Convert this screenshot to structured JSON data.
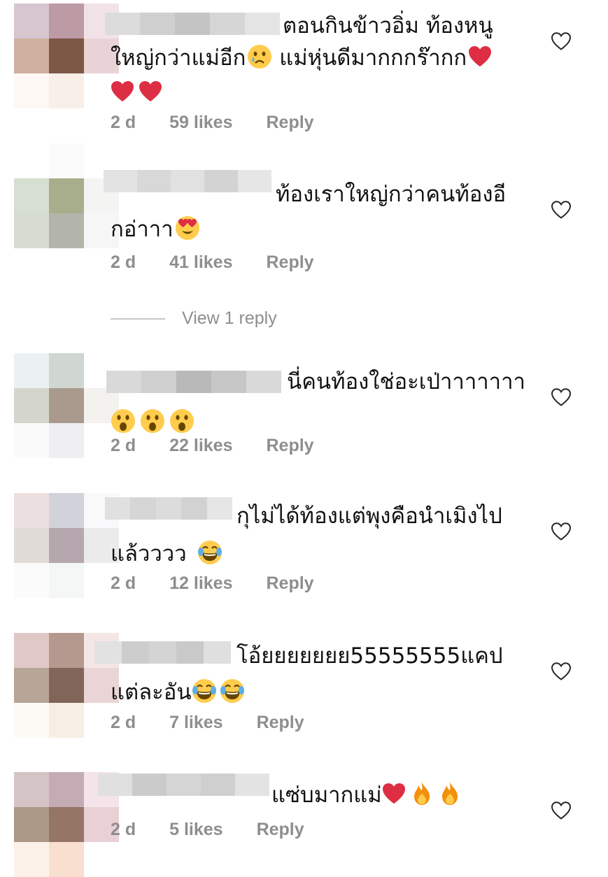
{
  "comments": [
    {
      "avatar_colors": [
        "#d7c5d0",
        "#bc9ba4",
        "#f1e2e8",
        "#cfb09f",
        "#7d5846",
        "#ead3d6",
        "#fdf8f4",
        "#f7efe8",
        "#ffffff"
      ],
      "username_blocks": [
        "#dcdcdc",
        "#cfcfcf",
        "#c4c4c4",
        "#d6d6d6",
        "#e4e4e4"
      ],
      "text_line1": "ตอนกินข้าวอิ่ม ท้องหนู",
      "text_line2": "ใหญ่กว่าแม่อีก",
      "text_line2b": " แม่หุ่นดีมากกกร๊ากก",
      "time": "2 d",
      "likes": "59 likes",
      "reply": "Reply"
    },
    {
      "avatar_colors": [
        "#ffffff",
        "#fbfbfb",
        "#ffffff",
        "#d6dfd1",
        "#a8ae8c",
        "#f4f5f3",
        "#d6dcd0",
        "#b3b5ab",
        "#f6f6f6"
      ],
      "username_blocks": [
        "#e3e3e3",
        "#d8d8d8",
        "#e1e1e1",
        "#d3d3d3",
        "#e6e6e6"
      ],
      "text_line1": "ท้องเราใหญ่กว่าคนท้องอี",
      "text_line2": "กอ่าาา",
      "time": "2 d",
      "likes": "41 likes",
      "reply": "Reply"
    },
    {
      "avatar_colors": [
        "#ebf1f3",
        "#d0d6d0",
        "#ffffff",
        "#d4d6cc",
        "#aa9a8e",
        "#f4f2ef",
        "#fbfafb",
        "#efeff2",
        "#ffffff"
      ],
      "username_blocks": [
        "#d9d9d9",
        "#cfcfcf",
        "#b9b9b9",
        "#c7c7c7",
        "#d9d9d9"
      ],
      "text_line1": "นี่คนท้องใช่อะเป่าาาาาาา",
      "time": "2 d",
      "likes": "22 likes",
      "reply": "Reply"
    },
    {
      "avatar_colors": [
        "#ecdfe0",
        "#d1d2da",
        "#f9f9fb",
        "#e1dbd8",
        "#b5a7ad",
        "#ecebeb",
        "#fbfbfb",
        "#f5f6f6",
        "#ffffff"
      ],
      "username_blocks": [
        "#e0e0e0",
        "#d6d6d6",
        "#dcdcdc",
        "#d2d2d2",
        "#e6e6e6"
      ],
      "text_line1": "กุไม่ได้ท้องแต่พุงคือนำเมิงไป",
      "text_line2": "แล้วววว",
      "time": "2 d",
      "likes": "12 likes",
      "reply": "Reply"
    },
    {
      "avatar_colors": [
        "#dfc8c5",
        "#b5998f",
        "#f5e6e6",
        "#b7a596",
        "#806558",
        "#ead5d6",
        "#fdfaf6",
        "#f5efe6",
        "#ffffff"
      ],
      "username_blocks": [
        "#e2e2e2",
        "#cdcdcd",
        "#d4d4d4",
        "#c9c9c9",
        "#dfdfdf"
      ],
      "text_line1": "โอ้ยยยยยยย55555555แคป",
      "text_line2": "แต่ละอัน",
      "time": "2 d",
      "likes": "7 likes",
      "reply": "Reply"
    },
    {
      "avatar_colors": [
        "#d4c4c6",
        "#c5acb4",
        "#f4e3e8",
        "#ab9886",
        "#957565",
        "#e9d0d4",
        "#fdf2ea",
        "#f8dfcf",
        "#ffffff"
      ],
      "username_blocks": [
        "#e0e0e0",
        "#cbcbcb",
        "#d5d5d5",
        "#cfcfcf",
        "#e3e3e3"
      ],
      "text_line1": "แซ่บมากแม่",
      "time": "2 d",
      "likes": "5 likes",
      "reply": "Reply"
    }
  ],
  "view_replies": "View 1 reply",
  "icons": {
    "like": "heart-outline-icon",
    "emoji_heart": "red-heart-emoji",
    "emoji_crying": "crying-face-emoji",
    "emoji_heart_eyes": "heart-eyes-emoji",
    "emoji_surprised": "surprised-face-emoji",
    "emoji_laughing": "tears-of-joy-emoji",
    "emoji_fire": "fire-emoji"
  },
  "colors": {
    "meta_text": "#8e8e8e",
    "heart_red": "#dd2e44",
    "emoji_yellow": "#ffcc4d"
  }
}
